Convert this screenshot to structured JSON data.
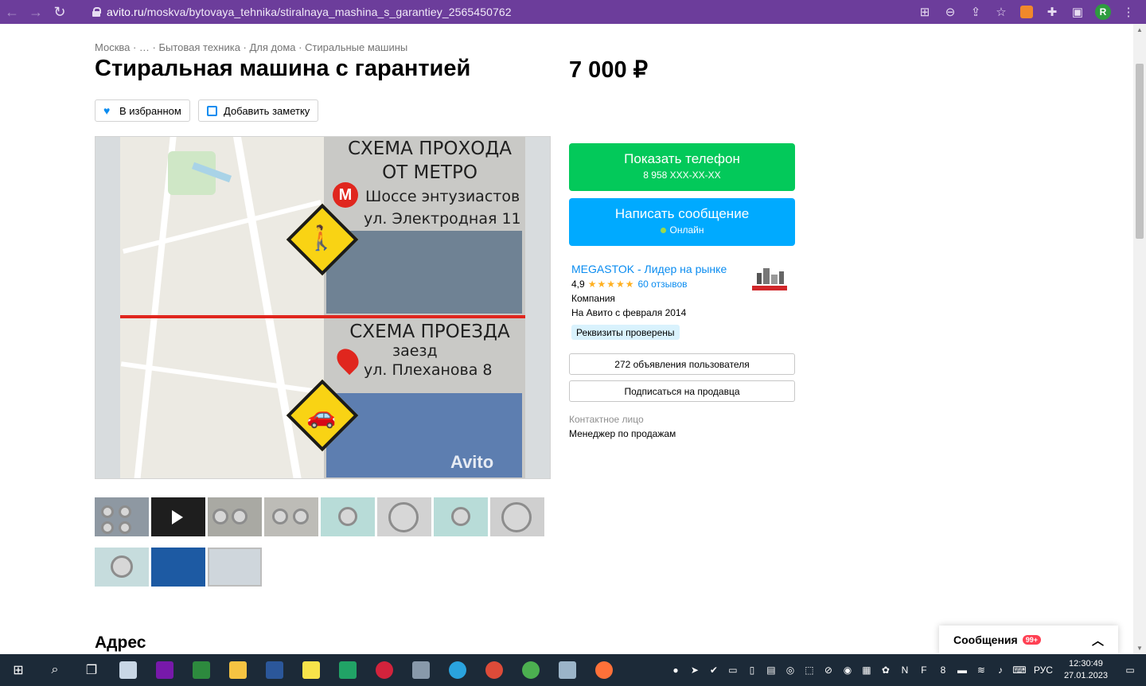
{
  "browser": {
    "url_host": "avito.ru",
    "url_path": "/moskva/bytovaya_tehnika/stiralnaya_mashina_s_garantiey_2565450762",
    "profile_initial": "R"
  },
  "listing": {
    "breadcrumbs": "Москва · … · Бытовая техника · Для дома · Стиральные машины",
    "title": "Стиральная машина с гарантией",
    "price": "7 000 ₽",
    "favorite_label": "В избранном",
    "note_label": "Добавить заметку"
  },
  "image": {
    "top_title_1": "СХЕМА ПРОХОДА",
    "top_title_2": "ОТ МЕТРО",
    "metro_letter": "M",
    "metro_station": "Шоссе энтузиастов",
    "street_1": "ул. Электродная 11",
    "bottom_title": "СХЕМА ПРОЕЗДА",
    "entry": "заезд",
    "street_2": "ул. Плеханова 8",
    "watermark": "Avito"
  },
  "contacts": {
    "phone_label": "Показать телефон",
    "phone_number": "8 958 XXX-XX-XX",
    "message_label": "Написать сообщение",
    "online_status": "Онлайн",
    "seller_name": "MEGASTOK - Лидер на рынке",
    "rating": "4,9",
    "rating_stars": 5,
    "reviews": "60 отзывов",
    "seller_type": "Компания",
    "since": "На Авито с февраля 2014",
    "verified": "Реквизиты проверены",
    "ads_count": "272 объявления пользователя",
    "subscribe": "Подписаться на продавца",
    "contact_person_label": "Контактное лицо",
    "contact_person": "Менеджер по продажам"
  },
  "address_heading": "Адрес",
  "messenger": {
    "label": "Сообщения",
    "badge": "99+"
  },
  "taskbar": {
    "language": "РУС",
    "time": "12:30:49",
    "date": "27.01.2023"
  }
}
